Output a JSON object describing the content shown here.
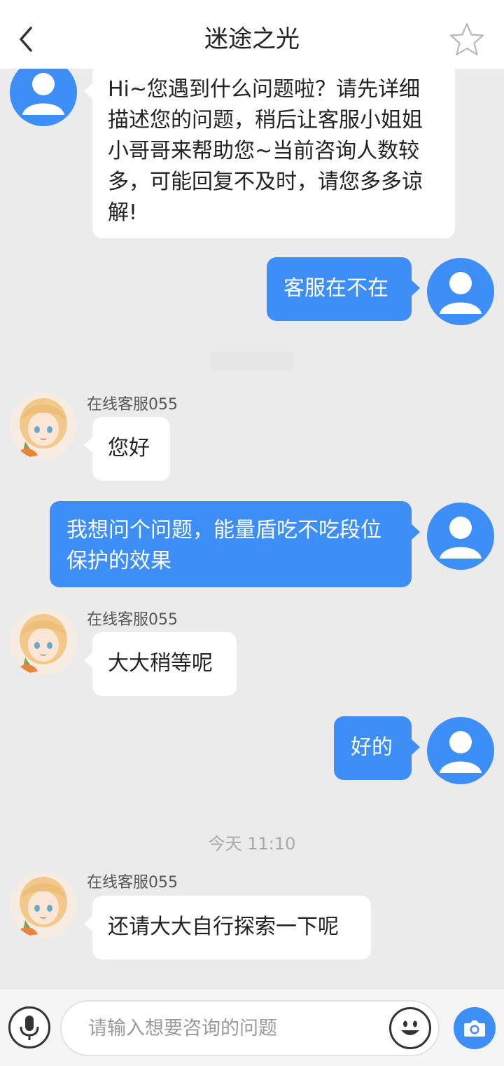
{
  "header": {
    "back_icon": "chevron-left-icon",
    "title": "迷途之光",
    "star_icon": "star-outline-icon"
  },
  "colors": {
    "accent": "#3e8ef7",
    "background": "#ebebeb",
    "bubble_left": "#ffffff",
    "timestamp_text": "#a8a8a8"
  },
  "messages": [
    {
      "side": "left",
      "avatar_icon": "default-user-avatar-icon",
      "text": "Hi~您遇到什么问题啦？请先详细描述您的问题，稍后让客服小姐姐小哥哥来帮助您~当前咨询人数较多，可能回复不及时，请您多多谅解!"
    },
    {
      "side": "right",
      "avatar_icon": "default-user-avatar-icon",
      "text": "客服在不在"
    },
    {
      "side": "left",
      "sender": "在线客服055",
      "avatar_icon": "agent-anime-avatar-icon",
      "text": "您好"
    },
    {
      "side": "right",
      "avatar_icon": "default-user-avatar-icon",
      "text": "我想问个问题，能量盾吃不吃段位保护的效果"
    },
    {
      "side": "left",
      "sender": "在线客服055",
      "avatar_icon": "agent-anime-avatar-icon",
      "text": "大大稍等呢"
    },
    {
      "side": "right",
      "avatar_icon": "default-user-avatar-icon",
      "text": "好的"
    },
    {
      "side": "left",
      "sender": "在线客服055",
      "avatar_icon": "agent-anime-avatar-icon",
      "text": "还请大大自行探索一下呢"
    }
  ],
  "timestamp": "今天 11:10",
  "input_bar": {
    "voice_icon": "microphone-icon",
    "placeholder": "请输入想要咨询的问题",
    "emoji_icon": "emoji-smile-icon",
    "camera_icon": "camera-icon"
  }
}
